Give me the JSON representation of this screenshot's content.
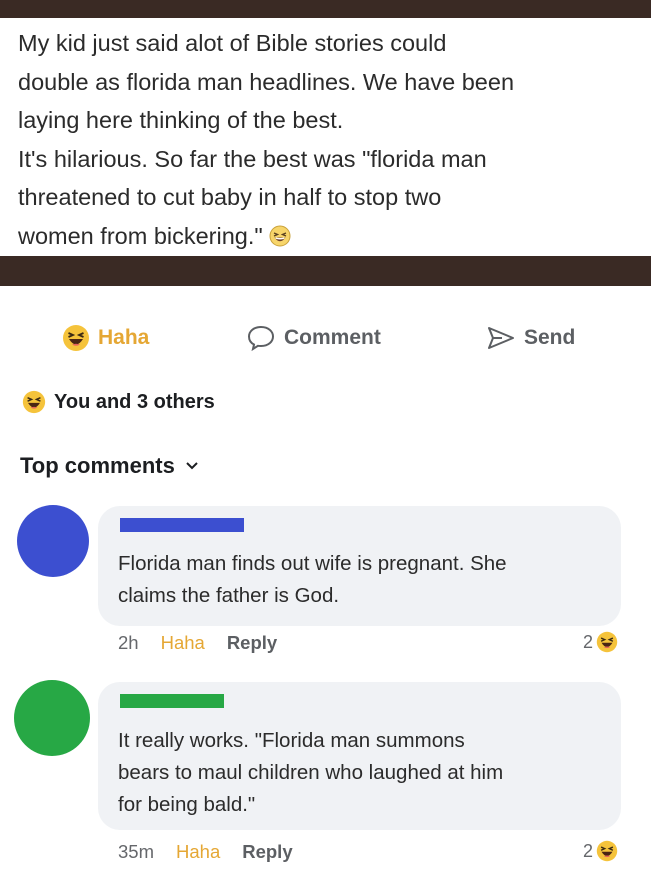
{
  "post": {
    "lines": [
      "My kid just said alot of Bible stories could",
      "double as florida man headlines. We have been",
      "laying here thinking of the best.",
      "It's hilarious. So far the best was \"florida man",
      "threatened to cut baby in half to stop two",
      "women from bickering.\""
    ]
  },
  "actions": {
    "haha_label": "Haha",
    "comment_label": "Comment",
    "send_label": "Send"
  },
  "reactions": {
    "text": "You and 3 others"
  },
  "top_comments": {
    "label": "Top comments"
  },
  "comments": [
    {
      "avatar_color": "#3c4fd0",
      "name_color": "#3c4fd0",
      "lines": [
        "Florida man finds out wife is pregnant. She",
        "claims the father is God."
      ],
      "time": "2h",
      "haha": "Haha",
      "reply": "Reply",
      "reaction_count": "2"
    },
    {
      "avatar_color": "#27a845",
      "name_color": "#27a845",
      "lines": [
        "It really works. \"Florida man summons",
        "bears to maul children who laughed at him",
        "for being bald.\""
      ],
      "time": "35m",
      "haha": "Haha",
      "reply": "Reply",
      "reaction_count": "2"
    }
  ],
  "colors": {
    "haha": "#e5a734",
    "bubble": "#f0f2f5",
    "bar": "#3a2a24"
  },
  "icons": [
    "laughing-emoji-icon",
    "haha-icon",
    "comment-icon",
    "send-icon",
    "chevron-down-icon"
  ]
}
